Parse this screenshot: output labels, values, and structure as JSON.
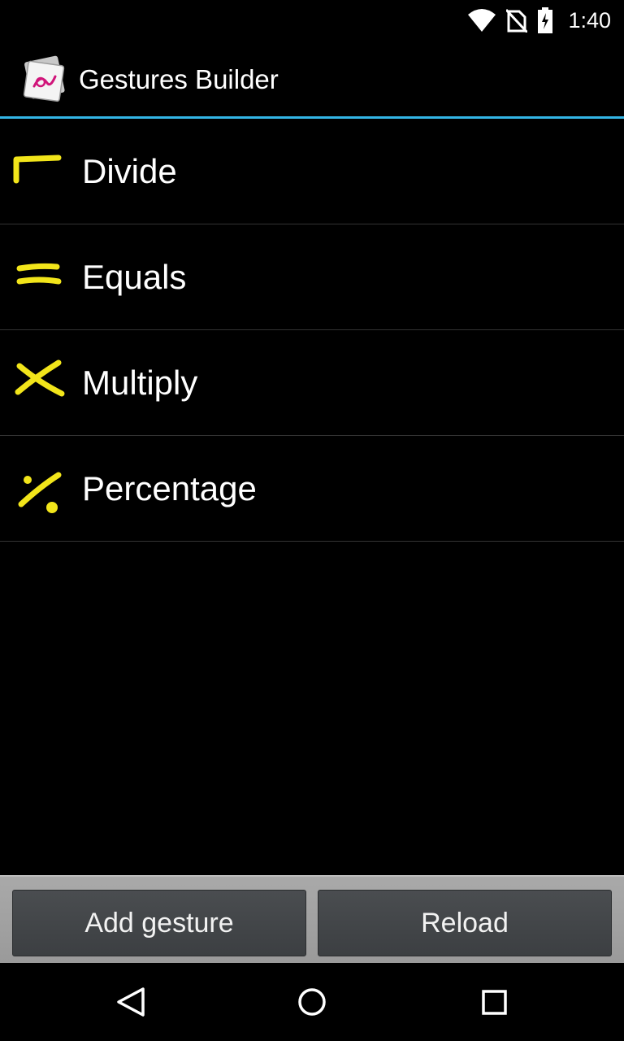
{
  "status_bar": {
    "time": "1:40",
    "icons": [
      "wifi-icon",
      "no-sim-icon",
      "battery-charging-icon"
    ]
  },
  "action_bar": {
    "title": "Gestures Builder",
    "icon": "gestures-app-icon",
    "divider_color": "#33b5e5"
  },
  "gestures": [
    {
      "label": "Divide",
      "thumb": "divide-gesture-icon"
    },
    {
      "label": "Equals",
      "thumb": "equals-gesture-icon"
    },
    {
      "label": "Multiply",
      "thumb": "multiply-gesture-icon"
    },
    {
      "label": "Percentage",
      "thumb": "percentage-gesture-icon"
    }
  ],
  "gesture_stroke_color": "#f2e51a",
  "buttons": {
    "add_label": "Add gesture",
    "reload_label": "Reload"
  },
  "nav_bar": {
    "icons": [
      "back-icon",
      "home-icon",
      "recent-apps-icon"
    ]
  }
}
